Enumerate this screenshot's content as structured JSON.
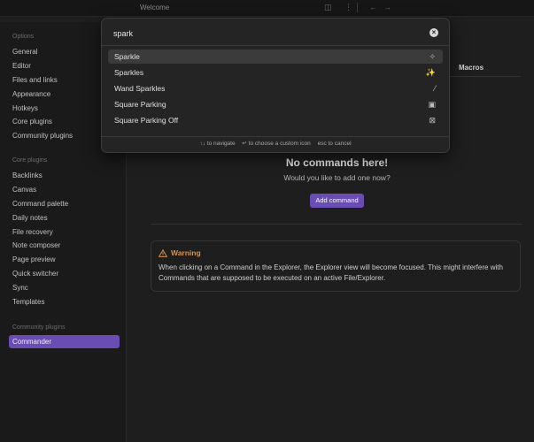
{
  "topbar": {
    "tab_title": "Welcome"
  },
  "sidebar": {
    "sections": [
      "Options",
      "Core plugins",
      "Community plugins"
    ],
    "options": [
      "General",
      "Editor",
      "Files and links",
      "Appearance",
      "Hotkeys",
      "Core plugins",
      "Community plugins"
    ],
    "core_plugins": [
      "Backlinks",
      "Canvas",
      "Command palette",
      "Daily notes",
      "File recovery",
      "Note composer",
      "Page preview",
      "Quick switcher",
      "Sync",
      "Templates"
    ],
    "community_plugins": [
      "Commander"
    ]
  },
  "content": {
    "tab_label": "Macros",
    "empty_title": "No commands here!",
    "empty_subtitle": "Would you like to add one now?",
    "add_button": "Add command",
    "warning_title": "Warning",
    "warning_body": "When clicking on a Command in the Explorer, the Explorer view will become focused. This might interfere with Commands that are supposed to be executed on an active File/Explorer."
  },
  "picker": {
    "search_value": "spark",
    "suggestions": [
      {
        "label": "Sparkle",
        "icon": "sparkle-icon"
      },
      {
        "label": "Sparkles",
        "icon": "sparkles-icon"
      },
      {
        "label": "Wand Sparkles",
        "icon": "wand-sparkles-icon"
      },
      {
        "label": "Square Parking",
        "icon": "square-parking-icon"
      },
      {
        "label": "Square Parking Off",
        "icon": "square-parking-off-icon"
      }
    ],
    "instructions": [
      "↑↓ to navigate",
      "↵ to choose a custom icon",
      "esc to cancel"
    ]
  },
  "colors": {
    "accent": "#6a4cb5",
    "warning": "#d7924c",
    "background": "#1e1e1e"
  }
}
